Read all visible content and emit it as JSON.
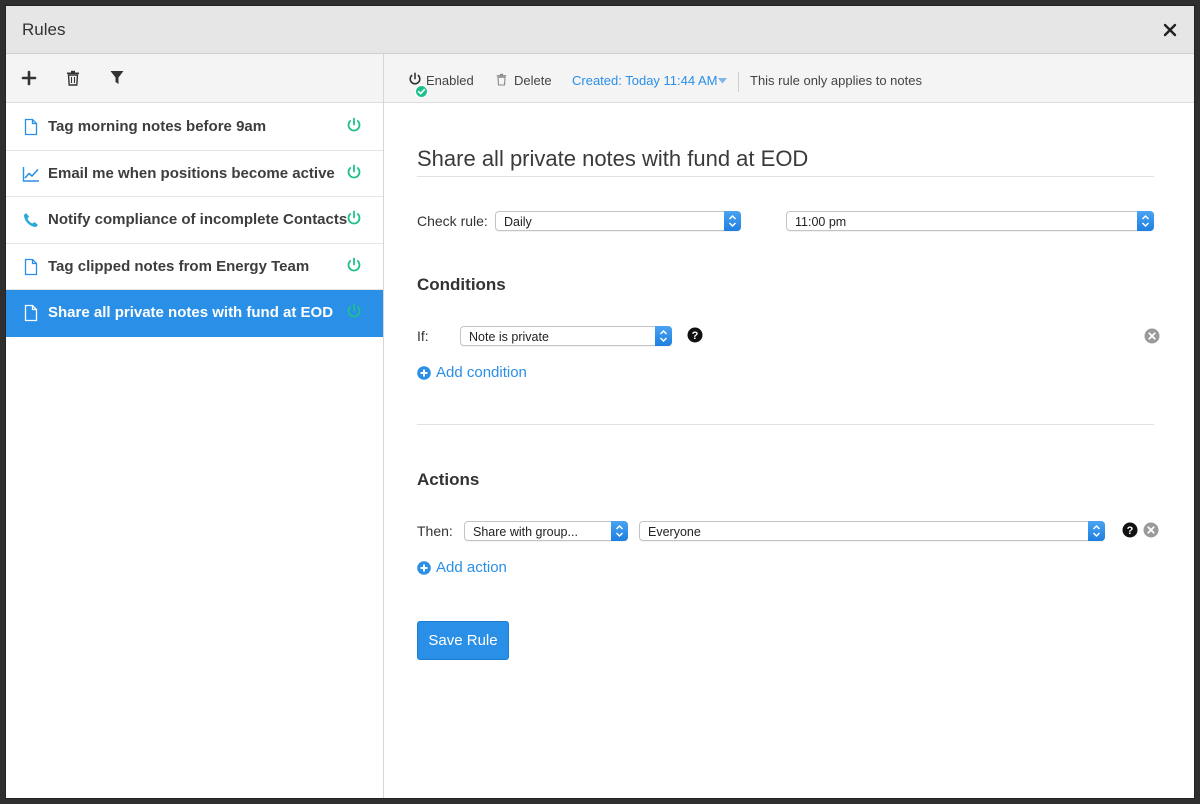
{
  "window": {
    "title": "Rules"
  },
  "sidebar": {
    "rules": [
      {
        "label": "Tag morning notes before 9am",
        "icon": "document-icon",
        "active": false
      },
      {
        "label": "Email me when positions become active",
        "icon": "line-chart-icon",
        "active": false
      },
      {
        "label": "Notify compliance of incomplete Contacts",
        "icon": "phone-icon",
        "active": false
      },
      {
        "label": "Tag clipped notes from Energy Team",
        "icon": "document-icon",
        "active": false
      },
      {
        "label": "Share all private notes with fund at EOD",
        "icon": "document-icon",
        "active": true
      }
    ]
  },
  "toolbar": {
    "enabled_label": "Enabled",
    "delete_label": "Delete",
    "created_label": "Created: Today 11:44 AM",
    "scope_text": "This rule only applies to notes"
  },
  "rule": {
    "title": "Share all private notes with fund at EOD",
    "check_rule_label": "Check rule:",
    "frequency": "Daily",
    "time": "11:00 pm"
  },
  "conditions": {
    "heading": "Conditions",
    "if_label": "If:",
    "condition": "Note is private",
    "add_label": "Add condition"
  },
  "actions": {
    "heading": "Actions",
    "then_label": "Then:",
    "action": "Share with group...",
    "target": "Everyone",
    "add_label": "Add action"
  },
  "save_label": "Save Rule",
  "colors": {
    "accent": "#2a8fe7",
    "power_green": "#1fc08e"
  }
}
